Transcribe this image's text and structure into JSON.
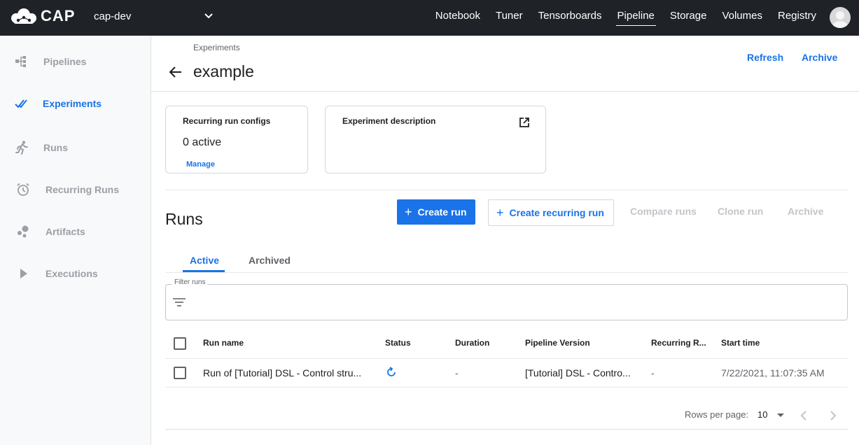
{
  "app": {
    "name": "CAP",
    "namespace": "cap-dev"
  },
  "topnav": [
    {
      "label": "Notebook",
      "active": false
    },
    {
      "label": "Tuner",
      "active": false
    },
    {
      "label": "Tensorboards",
      "active": false
    },
    {
      "label": "Pipeline",
      "active": true
    },
    {
      "label": "Storage",
      "active": false
    },
    {
      "label": "Volumes",
      "active": false
    },
    {
      "label": "Registry",
      "active": false
    }
  ],
  "sidebar": {
    "items": [
      {
        "label": "Pipelines",
        "icon": "pipelines-icon"
      },
      {
        "label": "Experiments",
        "icon": "experiments-icon",
        "active": true
      },
      {
        "label": "Runs",
        "icon": "runs-icon"
      },
      {
        "label": "Recurring Runs",
        "icon": "alarm-clock-icon"
      },
      {
        "label": "Artifacts",
        "icon": "artifacts-icon"
      },
      {
        "label": "Executions",
        "icon": "play-icon"
      }
    ]
  },
  "header": {
    "breadcrumb": "Experiments",
    "title": "example",
    "refresh": "Refresh",
    "archive": "Archive"
  },
  "cards": {
    "recurring": {
      "title": "Recurring run configs",
      "value": "0 active",
      "link": "Manage"
    },
    "description": {
      "title": "Experiment description"
    }
  },
  "runs": {
    "title": "Runs",
    "create_run": "Create run",
    "create_recurring": "Create recurring run",
    "compare": "Compare runs",
    "clone": "Clone run",
    "archive": "Archive",
    "tabs": {
      "active": "Active",
      "archived": "Archived"
    },
    "filter_label": "Filter runs",
    "columns": [
      "Run name",
      "Status",
      "Duration",
      "Pipeline Version",
      "Recurring R...",
      "Start time"
    ],
    "rows": [
      {
        "name": "Run of [Tutorial] DSL - Control stru...",
        "status": "running",
        "duration": "-",
        "pipeline_version": "[Tutorial] DSL - Contro...",
        "recurring": "-",
        "start_time": "7/22/2021, 11:07:35 AM"
      }
    ],
    "pager": {
      "label": "Rows per page:",
      "value": "10"
    }
  },
  "colors": {
    "accent": "#1a73e8",
    "topbar": "#1f2226",
    "disabled": "#c2c5c9"
  }
}
